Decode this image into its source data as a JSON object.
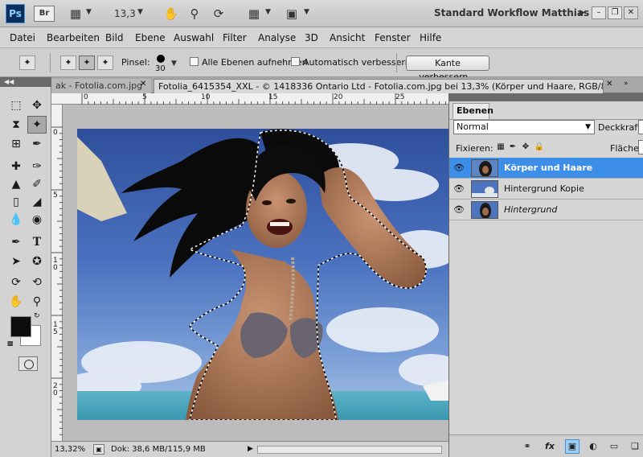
{
  "app": {
    "logo": "Ps",
    "bridge": "Br",
    "zoom_menu": "13,3",
    "workspace": "Standard Workflow Matthias"
  },
  "menu": [
    "Datei",
    "Bearbeiten",
    "Bild",
    "Ebene",
    "Auswahl",
    "Filter",
    "Analyse",
    "3D",
    "Ansicht",
    "Fenster",
    "Hilfe"
  ],
  "options": {
    "brush_label": "Pinsel:",
    "brush_size": "30",
    "all_layers": "Alle Ebenen aufnehmen",
    "auto_enhance": "Automatisch verbessern",
    "refine_edge": "Kante verbessern..."
  },
  "tabs": [
    {
      "label": "ak - Fotolia.com.jpg"
    },
    {
      "label": "Fotolia_6415354_XXL - © 1418336 Ontario Ltd - Fotolia.com.jpg bei 13,3% (Körper und Haare, RGB/8#) *"
    }
  ],
  "ruler": {
    "h": [
      "0",
      "5",
      "10",
      "15",
      "20",
      "25"
    ],
    "v": [
      "0",
      "5",
      "1\n0",
      "1\n5",
      "2\n0"
    ]
  },
  "status": {
    "zoom": "13,32%",
    "doc": "Dok: 38,6 MB/115,9 MB"
  },
  "layers_panel": {
    "tab": "Ebenen",
    "blend_mode": "Normal",
    "opacity_label": "Deckkraft:",
    "lock_label": "Fixieren:",
    "fill_label": "Fläche:",
    "layers": [
      {
        "name": "Körper und Haare",
        "selected": true
      },
      {
        "name": "Hintergrund Kopie",
        "selected": false
      },
      {
        "name": "Hintergrund",
        "selected": false
      }
    ]
  },
  "colors": {
    "foreground": "#0d0d0d",
    "background": "#ffffff",
    "selection": "#3d8ee8"
  }
}
